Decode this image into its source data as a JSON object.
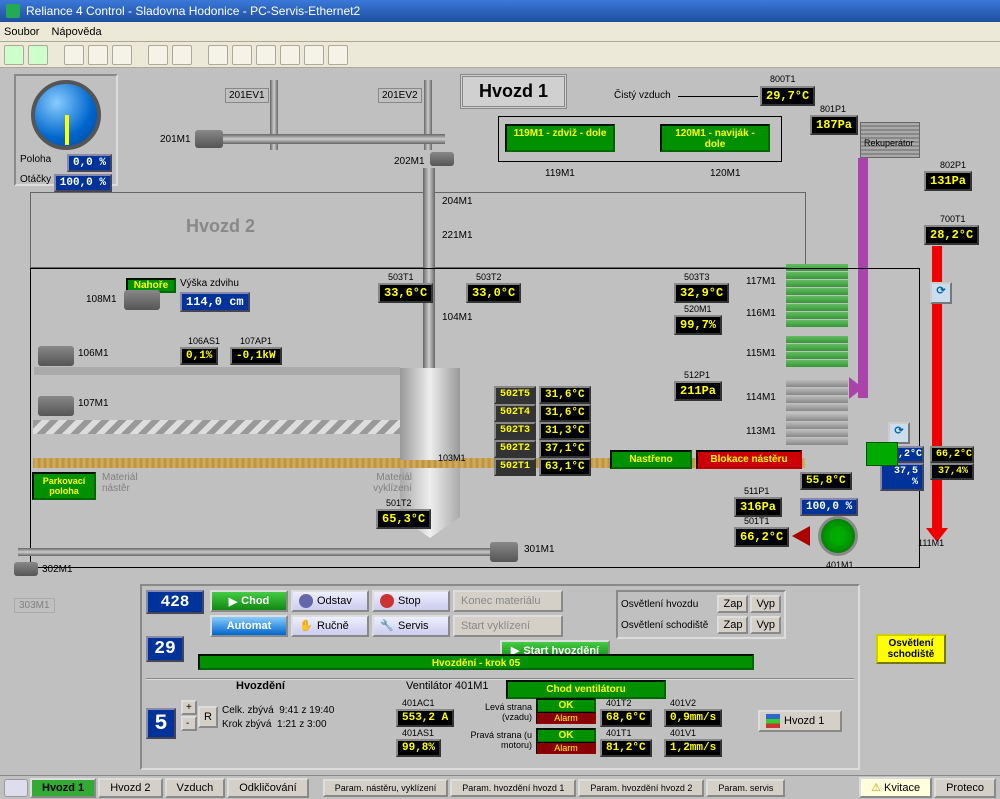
{
  "window": {
    "title": "Reliance 4 Control - Sladovna Hodonice - PC-Servis-Ethernet2"
  },
  "menu": {
    "file": "Soubor",
    "help": "Nápověda"
  },
  "header": {
    "title": "Hvozd 1",
    "clean_air": "Čistý vzduch"
  },
  "gauge": {
    "poloha_label": "Poloha",
    "poloha_val": "0,0 %",
    "otacky_label": "Otáčky",
    "otacky_val": "100,0 %"
  },
  "hvozd2_label": "Hvozd 2",
  "equip": {
    "201EV1": "201EV1",
    "201EV2": "201EV2",
    "201M1": "201M1",
    "202M1": "202M1",
    "204M1": "204M1",
    "221M1": "221M1",
    "106M1": "106M1",
    "107M1": "107M1",
    "108M1": "108M1",
    "104M1": "104M1",
    "103M1": "103M1",
    "301M1": "301M1",
    "302M1": "302M1",
    "303M1": "303M1",
    "401M1": "401M1",
    "111M1": "111M1",
    "113M1": "113M1",
    "114M1": "114M1",
    "115M1": "115M1",
    "116M1": "116M1",
    "117M1": "117M1",
    "119M1": "119M1",
    "120M1": "120M1",
    "rekuperator": "Rekuperátor"
  },
  "sensors": {
    "800T1": {
      "name": "800T1",
      "val": "29,7°C"
    },
    "801P1": {
      "name": "801P1",
      "val": "187Pa"
    },
    "802P1": {
      "name": "802P1",
      "val": "131Pa"
    },
    "700T1": {
      "name": "700T1",
      "val": "28,2°C"
    },
    "503T1": {
      "name": "503T1",
      "val": "33,6°C"
    },
    "503T2": {
      "name": "503T2",
      "val": "33,0°C"
    },
    "503T3": {
      "name": "503T3",
      "val": "32,9°C"
    },
    "520M1": {
      "name": "520M1",
      "val": "99,7%"
    },
    "512P1": {
      "name": "512P1",
      "val": "211Pa"
    },
    "502T5": {
      "name": "502T5",
      "val": "31,6°C"
    },
    "502T4": {
      "name": "502T4",
      "val": "31,6°C"
    },
    "502T3": {
      "name": "502T3",
      "val": "31,3°C"
    },
    "502T2": {
      "name": "502T2",
      "val": "37,1°C"
    },
    "502T1": {
      "name": "502T1",
      "val": "63,1°C"
    },
    "501T2": {
      "name": "501T2",
      "val": "65,3°C"
    },
    "501T1": {
      "name": "501T1",
      "val": "66,2°C"
    },
    "511P1": {
      "name": "511P1",
      "val": "316Pa"
    },
    "106AS1": {
      "name": "106AS1",
      "val": "0,1%"
    },
    "107AP1": {
      "name": "107AP1",
      "val": "-0,1kW"
    },
    "side1": "55,8°C",
    "side2": "100,0 %",
    "quad1": "66,2°C",
    "quad2": "66,2°C",
    "quad3": "37,5 %",
    "quad4": "37,4%"
  },
  "lifts": {
    "m119": "119M1 - zdviž - dole",
    "m120": "120M1 - naviják - dole",
    "nahore": "Nahoře",
    "vyska": "Výška zdvihu",
    "vyska_val": "114,0 cm"
  },
  "status": {
    "nastreno": "Nastřeno",
    "blokace": "Blokace nástěru",
    "park": "Parkovací poloha",
    "mat_nast": "Materiál nástěr",
    "mat_vykl": "Materiál vyklízení",
    "osv_schod": "Osvětlení schodiště"
  },
  "control": {
    "counter": "428",
    "seq": "29",
    "chod": "Chod",
    "odstav": "Odstav",
    "stop": "Stop",
    "konec": "Konec materiálu",
    "automat": "Automat",
    "rucne": "Ručně",
    "servis": "Servis",
    "start_vykl": "Start vyklízení",
    "start_hvoz": "Start hvozdění",
    "osv_hvozdu": "Osvětlení hvozdu",
    "osv_schodiste": "Osvětlení schodiště",
    "zap": "Zap",
    "vyp": "Vyp",
    "step_text": "Hvozdění - krok 05",
    "hvozdeni": "Hvozdění",
    "ventilator": "Ventilátor 401M1",
    "chod_vent": "Chod ventilátoru",
    "step5": "5",
    "celk": "Celk. zbývá",
    "celk_val": "9:41 z 19:40",
    "krok": "Krok zbývá",
    "krok_val": "1:21 z  3:00",
    "401AC1": {
      "name": "401AC1",
      "val": "553,2 A"
    },
    "401AS1": {
      "name": "401AS1",
      "val": "99,8%"
    },
    "leva": "Levá strana (vzadu)",
    "prava": "Pravá strana (u motoru)",
    "ok": "OK",
    "alarm": "Alarm",
    "401T2": {
      "name": "401T2",
      "val": "68,6°C"
    },
    "401T1": {
      "name": "401T1",
      "val": "81,2°C"
    },
    "401V2": {
      "name": "401V2",
      "val": "0,9mm/s"
    },
    "401V1": {
      "name": "401V1",
      "val": "1,2mm/s"
    },
    "hvozd1_btn": "Hvozd 1",
    "R": "R",
    "plus": "+",
    "minus": "-"
  },
  "tabs": {
    "hvozd1": "Hvozd 1",
    "hvozd2": "Hvozd 2",
    "vzduch": "Vzduch",
    "odklic": "Odkličování",
    "param1": "Param. nástěru, vyklízení",
    "param2": "Param. hvozdění hvozd 1",
    "param3": "Param. hvozdění hvozd 2",
    "param4": "Param. servis",
    "kvitace": "Kvitace",
    "proteco": "Proteco"
  }
}
